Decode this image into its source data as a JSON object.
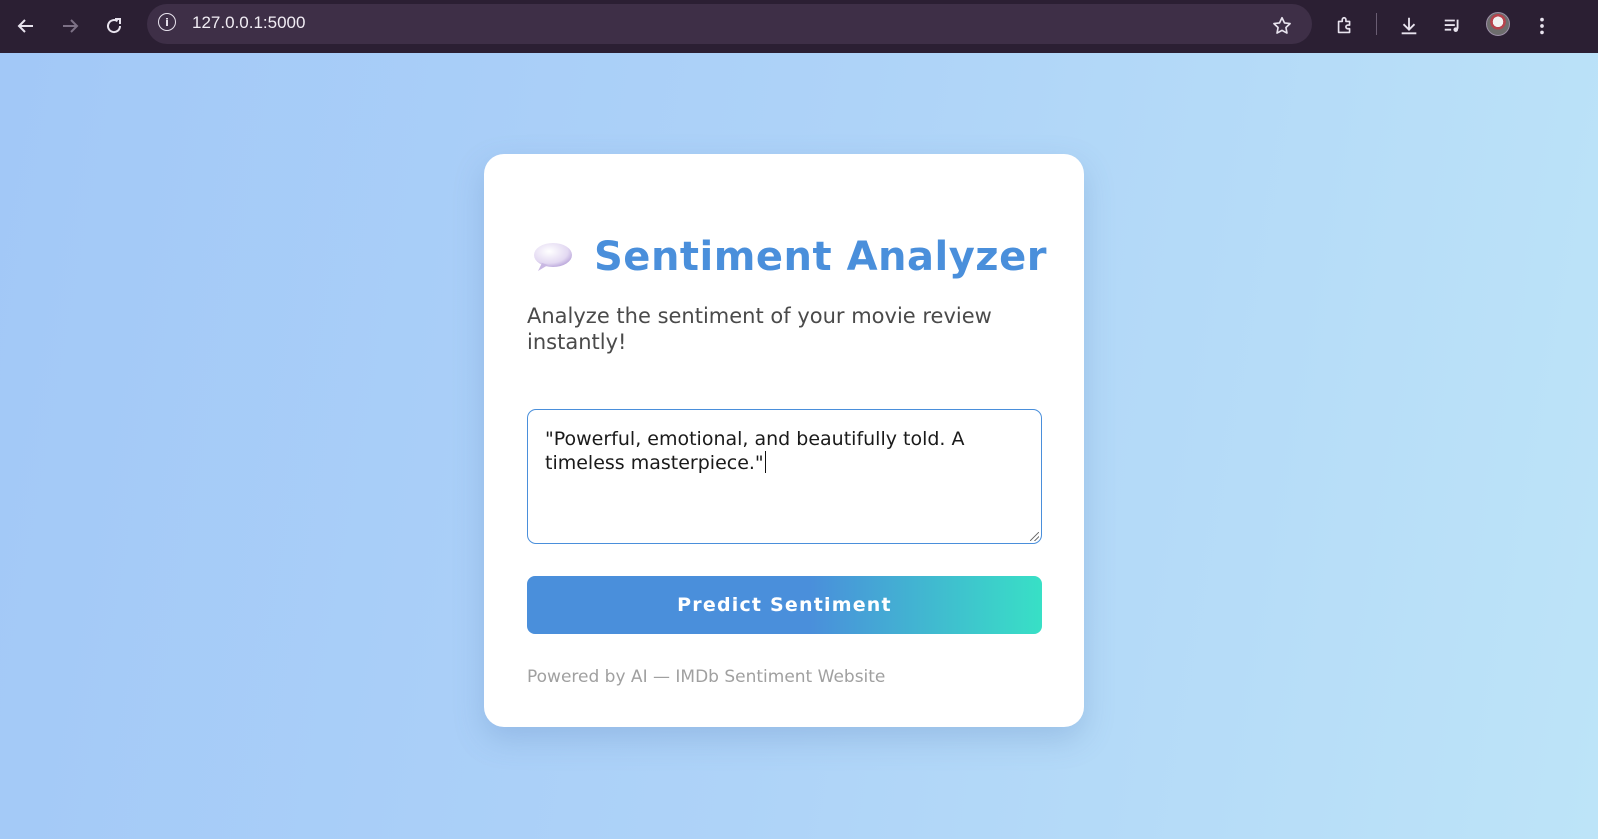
{
  "browser": {
    "url": "127.0.0.1:5000",
    "icons": {
      "back": "arrow-left-icon",
      "forward": "arrow-right-icon",
      "reload": "reload-icon",
      "site_info": "info-icon",
      "bookmark": "star-icon",
      "extensions": "puzzle-icon",
      "downloads": "download-icon",
      "media": "media-queue-icon",
      "menu": "kebab-menu-icon"
    }
  },
  "app": {
    "title_icon": "speech-bubble-icon",
    "title": "Sentiment Analyzer",
    "subtitle": "Analyze the sentiment of your movie review instantly!",
    "review_text": "\"Powerful, emotional, and beautifully told. A timeless masterpiece.\"",
    "predict_label": "Predict Sentiment",
    "footer": "Powered by AI — IMDb Sentiment Website"
  },
  "colors": {
    "accent": "#4a8fdb",
    "accent_end": "#38e0c6",
    "background_start": "#a2c8f7",
    "background_end": "#bde4f8",
    "browser_chrome": "#2b1f33"
  }
}
